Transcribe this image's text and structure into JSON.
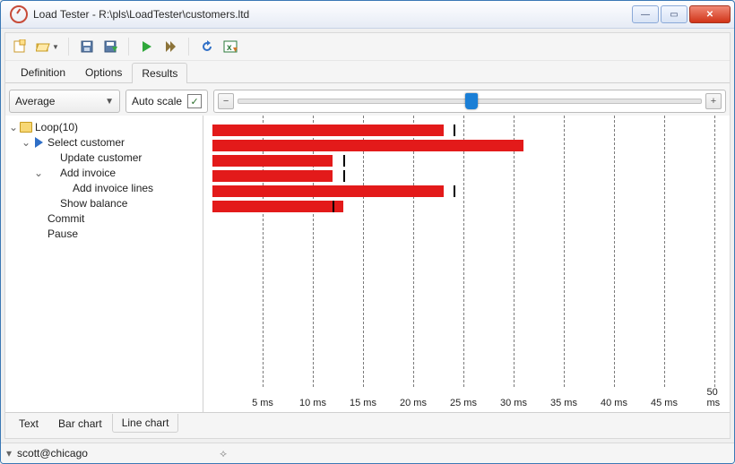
{
  "window": {
    "title": "Load Tester - R:\\pls\\LoadTester\\customers.ltd"
  },
  "tabs": {
    "definition": "Definition",
    "options": "Options",
    "results": "Results"
  },
  "controls": {
    "metric": "Average",
    "autoscale_label": "Auto scale",
    "autoscale_checked": "✓",
    "zoom_minus": "−",
    "zoom_plus": "+"
  },
  "tree": {
    "root": "Loop(10)",
    "n1": "Select customer",
    "n1a": "Update customer",
    "n1b": "Add invoice",
    "n1b1": "Add invoice lines",
    "n1c": "Show balance",
    "n2": "Commit",
    "n3": "Pause"
  },
  "bottom_tabs": {
    "text": "Text",
    "bar": "Bar chart",
    "line": "Line chart"
  },
  "status": {
    "user": "scott@chicago"
  },
  "chart_data": {
    "type": "bar",
    "orientation": "horizontal",
    "xlabel": "ms",
    "xlim": [
      0,
      50
    ],
    "xticks": [
      5,
      10,
      15,
      20,
      25,
      30,
      35,
      40,
      45,
      50
    ],
    "series": [
      {
        "name": "Select customer",
        "value": 23,
        "marker": 24
      },
      {
        "name": "Update customer",
        "value": 31
      },
      {
        "name": "Add invoice",
        "value": 12,
        "marker": 13
      },
      {
        "name": "Add invoice lines",
        "value": 12,
        "marker": 13
      },
      {
        "name": "Show balance",
        "value": 23,
        "marker": 24
      },
      {
        "name": "Commit",
        "value": 13,
        "marker": 12
      }
    ],
    "tick_labels": [
      "5 ms",
      "10 ms",
      "15 ms",
      "20 ms",
      "25 ms",
      "30 ms",
      "35 ms",
      "40 ms",
      "45 ms",
      "50 ms"
    ]
  }
}
